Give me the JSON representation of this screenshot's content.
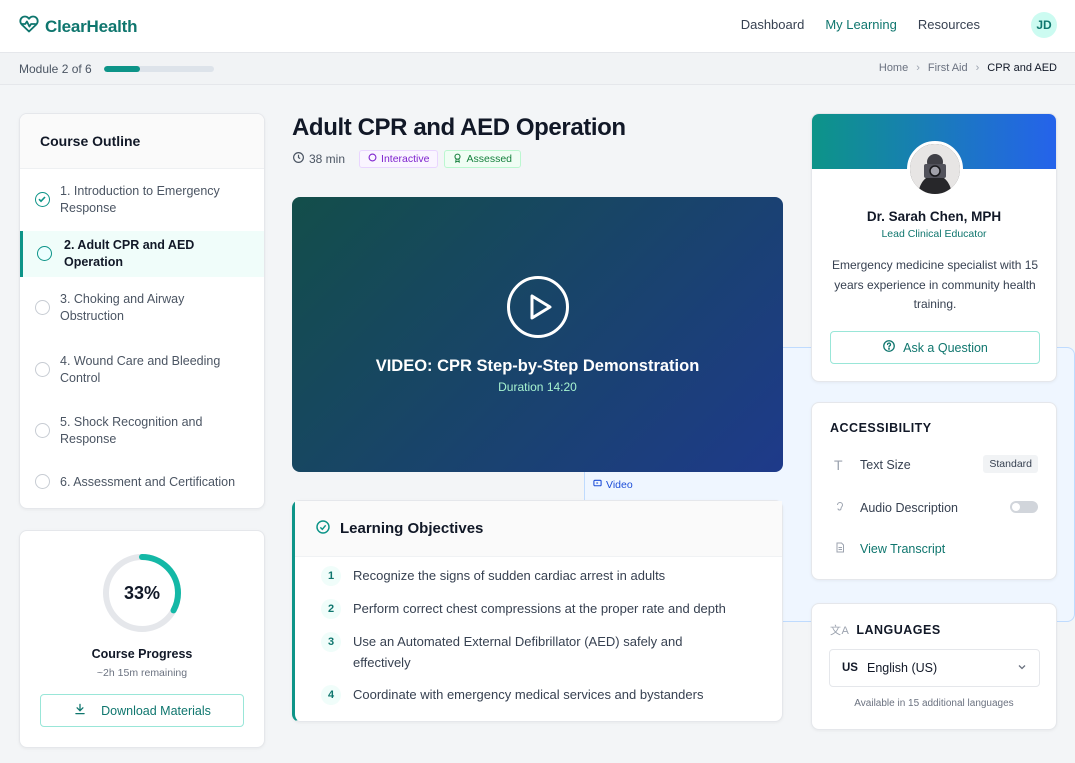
{
  "brand": {
    "name": "ClearHealth",
    "accent": "#0f766e"
  },
  "nav": {
    "links": [
      {
        "label": "Dashboard",
        "active": false
      },
      {
        "label": "My Learning",
        "active": true
      },
      {
        "label": "Resources",
        "active": false
      }
    ],
    "avatar_initials": "JD"
  },
  "subbar": {
    "module_label": "Module 2 of 6",
    "module_progress_fraction": 0.33,
    "breadcrumb": [
      "Home",
      "First Aid",
      "CPR and AED"
    ]
  },
  "outline": {
    "title": "Course Outline",
    "items": [
      {
        "label": "1. Introduction to Emergency Response",
        "status": "done"
      },
      {
        "label": "2. Adult CPR and AED Operation",
        "status": "current"
      },
      {
        "label": "3. Choking and Airway Obstruction",
        "status": "pending"
      },
      {
        "label": "4. Wound Care and Bleeding Control",
        "status": "pending"
      },
      {
        "label": "5. Shock Recognition and Response",
        "status": "pending"
      },
      {
        "label": "6. Assessment and Certification",
        "status": "pending"
      }
    ]
  },
  "progress": {
    "percent_label": "33%",
    "percent_value": 33,
    "title": "Course Progress",
    "remaining": "~2h 15m remaining",
    "download_label": "Download Materials"
  },
  "lesson": {
    "title": "Adult CPR and AED Operation",
    "duration": "38 min",
    "chips": {
      "video": "Video",
      "interactive": "Interactive",
      "assessed": "Assessed"
    },
    "video_title": "VIDEO: CPR Step-by-Step Demonstration",
    "video_duration": "Duration 14:20"
  },
  "objectives": {
    "title": "Learning Objectives",
    "items": [
      {
        "num": "1",
        "text": "Recognize the signs of sudden cardiac arrest in adults"
      },
      {
        "num": "2",
        "text": "Perform correct chest compressions at the proper rate and depth"
      },
      {
        "num": "3",
        "text": "Use an Automated External Defibrillator (AED) safely and effectively"
      },
      {
        "num": "4",
        "text": "Coordinate with emergency medical services and bystanders"
      }
    ]
  },
  "instructor": {
    "name": "Dr. Sarah Chen, MPH",
    "role": "Lead Clinical Educator",
    "bio": "Emergency medicine specialist with 15 years experience in community health training.",
    "ask_label": "Ask a Question"
  },
  "accessibility": {
    "title": "ACCESSIBILITY",
    "text_size_label": "Text Size",
    "text_size_value": "Standard",
    "audio_label": "Audio Description",
    "audio_on": false,
    "transcript_label": "View Transcript"
  },
  "languages": {
    "title": "LANGUAGES",
    "selected_code": "US",
    "selected_label": "English (US)",
    "note": "Available in 15 additional languages"
  }
}
